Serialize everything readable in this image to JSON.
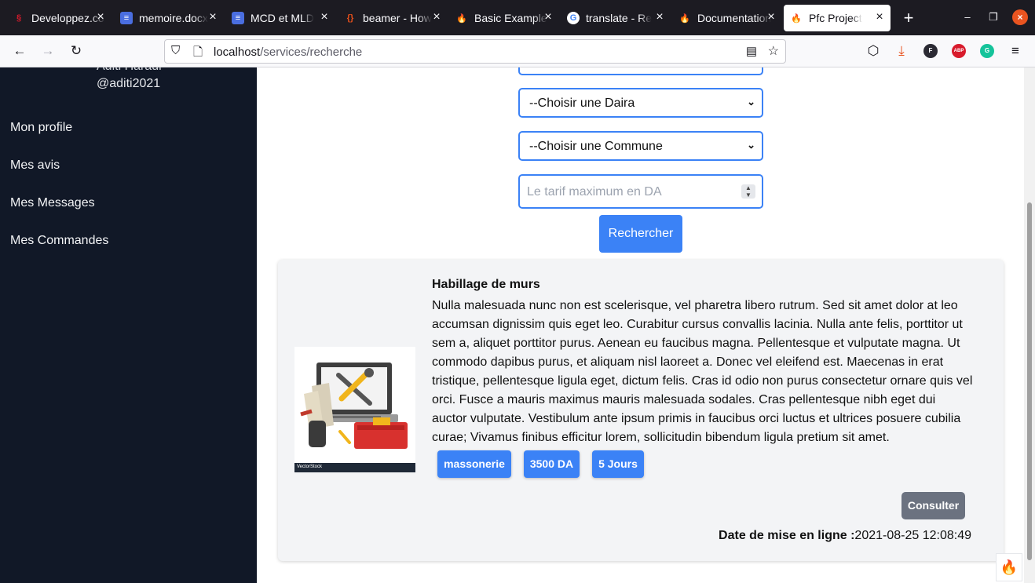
{
  "browser": {
    "tabs": [
      {
        "title": "Developpez.com",
        "favicon": "developpez-icon"
      },
      {
        "title": "memoire.docx",
        "favicon": "docs-icon"
      },
      {
        "title": "MCD et MLD",
        "favicon": "docs-icon"
      },
      {
        "title": "beamer - How",
        "favicon": "overleaf-icon"
      },
      {
        "title": "Basic Example",
        "favicon": "codeigniter-icon"
      },
      {
        "title": "translate - Re",
        "favicon": "google-icon"
      },
      {
        "title": "Documentation",
        "favicon": "codeigniter-icon"
      },
      {
        "title": "Pfc Project",
        "favicon": "codeigniter-icon"
      }
    ],
    "url_host": "localhost",
    "url_path": "/services/recherche"
  },
  "sidebar": {
    "name": "Aditi Haradi",
    "handle": "@aditi2021",
    "items": [
      "Mon profile",
      "Mes avis",
      "Mes Messages",
      "Mes Commandes"
    ]
  },
  "form": {
    "daira_select": "--Choisir une Daira",
    "commune_select": "--Choisir une Commune",
    "tarif_placeholder": "Le tarif maximum en DA",
    "search_button": "Rechercher"
  },
  "result": {
    "title": "Habillage de murs",
    "description": "Nulla malesuada nunc non est scelerisque, vel pharetra libero rutrum. Sed sit amet dolor at leo accumsan dignissim quis eget leo. Curabitur cursus convallis lacinia. Nulla ante felis, porttitor ut sem a, aliquet porttitor purus. Aenean eu faucibus magna. Pellentesque et vulputate magna. Ut commodo dapibus purus, et aliquam nisl laoreet a. Donec vel eleifend est. Maecenas in erat tristique, pellentesque ligula eget, dictum felis. Cras id odio non purus consectetur ornare quis vel orci. Fusce a mauris maximus mauris malesuada sodales. Cras pellentesque nibh eget dui auctor vulputate. Vestibulum ante ipsum primis in faucibus orci luctus et ultrices posuere cubilia curae; Vivamus finibus efficitur lorem, sollicitudin bibendum ligula pretium sit amet.",
    "badges": [
      "massonerie",
      "3500 DA",
      "5 Jours"
    ],
    "consult_button": "Consulter",
    "date_label": "Date de mise en ligne :",
    "date_value": "2021-08-25 12:08:49",
    "image_watermark": "VectorStock"
  },
  "colors": {
    "primary": "#3b82f6",
    "sidebar_bg": "#111827",
    "consult_bg": "#6b7280"
  }
}
